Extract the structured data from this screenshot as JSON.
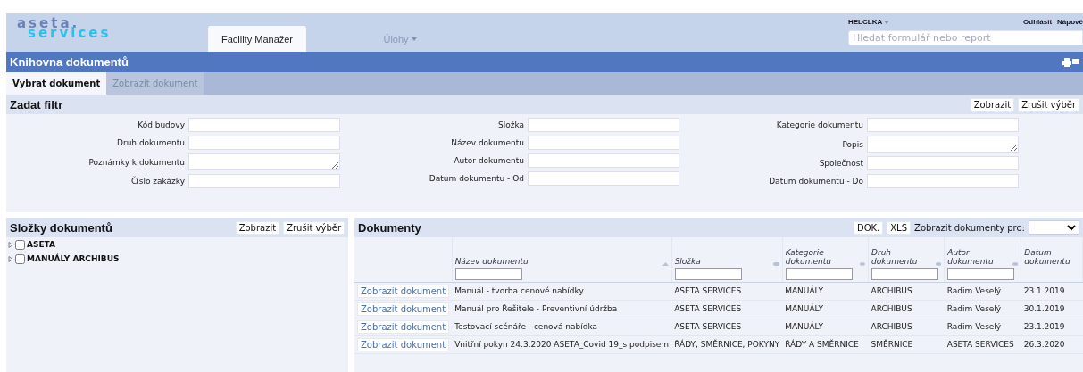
{
  "header": {
    "logo": {
      "line1": "aseta.",
      "line2": "services"
    },
    "nav_tabs": [
      {
        "label": "Facility Manažer",
        "selected": true,
        "dropdown": false
      },
      {
        "label": "Úlohy",
        "selected": false,
        "dropdown": true
      }
    ],
    "user": "HELCLKA",
    "links": [
      "Odhlásit",
      "Nápově"
    ],
    "search": {
      "placeholder": "Hledat formulář nebo report"
    }
  },
  "title_bar": {
    "title": "Knihovna dokumentů"
  },
  "tabs": [
    {
      "label": "Vybrat dokument",
      "selected": true,
      "disabled": false
    },
    {
      "label": "Zobrazit dokument",
      "selected": false,
      "disabled": true
    }
  ],
  "filter": {
    "title": "Zadat filtr",
    "buttons": [
      "Zobrazit",
      "Zrušit výběr"
    ],
    "columns": [
      [
        {
          "label": "Kód budovy",
          "kind": "input"
        },
        {
          "label": "Druh dokumentu",
          "kind": "input"
        },
        {
          "label": "Poznámky k dokumentu",
          "kind": "textarea"
        },
        {
          "label": "Číslo zakázky",
          "kind": "input"
        }
      ],
      [
        {
          "label": "Složka",
          "kind": "input"
        },
        {
          "label": "Název dokumentu",
          "kind": "input"
        },
        {
          "label": "Autor dokumentu",
          "kind": "input"
        },
        {
          "label": "Datum dokumentu - Od",
          "kind": "input"
        }
      ],
      [
        {
          "label": "Kategorie dokumentu",
          "kind": "input"
        },
        {
          "label": "Popis",
          "kind": "textarea"
        },
        {
          "label": "Společnost",
          "kind": "input"
        },
        {
          "label": "Datum dokumentu - Do",
          "kind": "input"
        }
      ]
    ]
  },
  "folders": {
    "title": "Složky dokumentů",
    "buttons": [
      "Zobrazit",
      "Zrušit výběr"
    ],
    "items": [
      {
        "label": "ASETA",
        "checked": false,
        "expanded": false
      },
      {
        "label": "MANUÁLY ARCHIBUS",
        "checked": false,
        "expanded": false
      }
    ]
  },
  "documents": {
    "title": "Dokumenty",
    "buttons": [
      "DOK.",
      "XLS"
    ],
    "show_for_label": "Zobrazit dokumenty pro:",
    "columns": [
      {
        "label": "Název dokumentu",
        "filter": true,
        "sortable": true,
        "sorted": true
      },
      {
        "label": "Složka",
        "filter": true,
        "sortable": true,
        "sorted": false
      },
      {
        "label": "Kategorie dokumentu",
        "filter": true,
        "sortable": true,
        "sorted": false
      },
      {
        "label": "Druh dokumentu",
        "filter": true,
        "sortable": true,
        "sorted": false
      },
      {
        "label": "Autor dokumentu",
        "filter": true,
        "sortable": true,
        "sorted": false
      },
      {
        "label": "Datum dokumentu",
        "filter": false,
        "sortable": false
      }
    ],
    "rows": [
      {
        "action": "Zobrazit dokument",
        "cells": [
          "Manuál - tvorba cenové nabídky",
          "ASETA SERVICES",
          "MANUÁLY",
          "ARCHIBUS",
          "Radim Veselý",
          "23.1.2019"
        ]
      },
      {
        "action": "Zobrazit dokument",
        "cells": [
          "Manuál pro Řešitele - Preventivní údržba",
          "ASETA SERVICES",
          "MANUÁLY",
          "ARCHIBUS",
          "Radim Veselý",
          "30.1.2019"
        ]
      },
      {
        "action": "Zobrazit dokument",
        "cells": [
          "Testovací scénáře - cenová nabídka",
          "ASETA SERVICES",
          "MANUÁLY",
          "ARCHIBUS",
          "Radim Veselý",
          "23.1.2019"
        ]
      },
      {
        "action": "Zobrazit dokument",
        "cells": [
          "Vnitřní pokyn 24.3.2020 ASETA_Covid 19_s podpisem",
          "ŘÁDY, SMĚRNICE, POKYNY",
          "ŘÁDY A SMĚRNICE",
          "SMĚRNICE",
          "ASETA SERVICES",
          "26.3.2020"
        ]
      }
    ]
  }
}
